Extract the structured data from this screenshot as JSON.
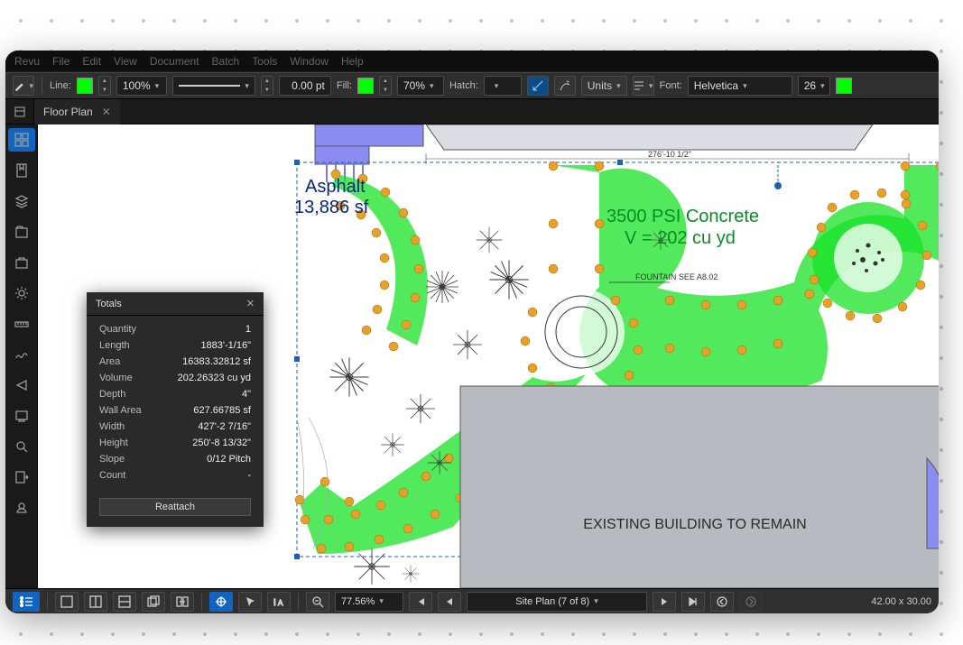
{
  "menubar": [
    "Revu",
    "File",
    "Edit",
    "View",
    "Document",
    "Batch",
    "Tools",
    "Window",
    "Help"
  ],
  "toolbar": {
    "line_label": "Line:",
    "line_width_pct": "100%",
    "point_value": "0.00 pt",
    "fill_label": "Fill:",
    "fill_pct": "70%",
    "hatch_label": "Hatch:",
    "units_label": "Units",
    "font_label": "Font:",
    "font_value": "Helvetica",
    "font_size": "26"
  },
  "tab": {
    "title": "Floor Plan"
  },
  "canvas": {
    "dimension_top": "276'-10 1/2\"",
    "asphalt_line1": "Asphalt",
    "asphalt_line2": "13,886 sf",
    "concrete_line1": "3500 PSI Concrete",
    "concrete_line2": "V = 202 cu yd",
    "fountain_note": "FOUNTAIN SEE A8.02",
    "existing_bldg": "EXISTING BUILDING TO REMAIN"
  },
  "totals": {
    "title": "Totals",
    "rows": [
      {
        "k": "Quantity",
        "v": "1"
      },
      {
        "k": "Length",
        "v": "1883'-1/16\""
      },
      {
        "k": "Area",
        "v": "16383.32812 sf"
      },
      {
        "k": "Volume",
        "v": "202.26323 cu yd"
      },
      {
        "k": "Depth",
        "v": "4\""
      },
      {
        "k": "Wall Area",
        "v": "627.66785 sf"
      },
      {
        "k": "Width",
        "v": "427'-2 7/16\""
      },
      {
        "k": "Height",
        "v": "250'-8 13/32\""
      },
      {
        "k": "Slope",
        "v": "0/12 Pitch"
      },
      {
        "k": "Count",
        "v": "-"
      }
    ],
    "reattach": "Reattach"
  },
  "statusbar": {
    "zoom": "77.56%",
    "page_label": "Site Plan (7 of 8)",
    "dimensions": "42.00 x 30.00"
  }
}
